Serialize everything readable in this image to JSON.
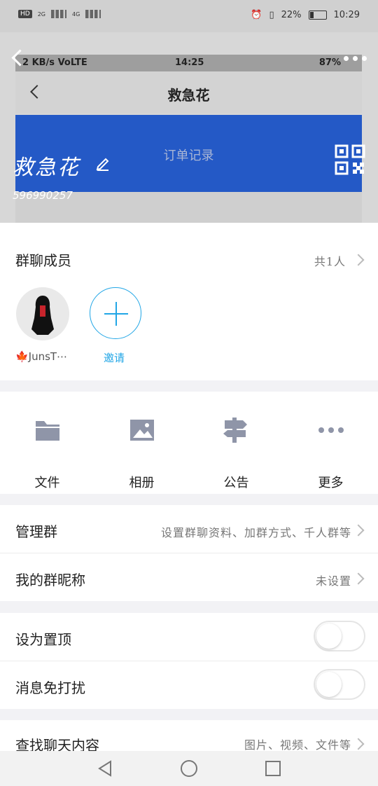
{
  "status_bar": {
    "left_badges": [
      "HD",
      "2G",
      "4G"
    ],
    "battery": "22%",
    "time": "10:29"
  },
  "inner_screenshot": {
    "status_left": "2 KB/s VoLTE",
    "status_time": "14:25",
    "status_right": "87%",
    "title": "救急花",
    "blue_button": "订单记录"
  },
  "header": {
    "group_name": "救急花",
    "group_id": "596990257"
  },
  "members": {
    "title": "群聊成员",
    "count": "共1人",
    "member_name": "🍁JunsT⋯",
    "invite_label": "邀请"
  },
  "functions": [
    {
      "label": "文件",
      "icon": "folder-icon"
    },
    {
      "label": "相册",
      "icon": "image-icon"
    },
    {
      "label": "公告",
      "icon": "signpost-icon"
    },
    {
      "label": "更多",
      "icon": "more-icon"
    }
  ],
  "settings": {
    "manage": {
      "label": "管理群",
      "value": "设置群聊资料、加群方式、千人群等"
    },
    "nickname": {
      "label": "我的群昵称",
      "value": "未设置"
    },
    "pin": {
      "label": "设为置顶",
      "on": false
    },
    "mute": {
      "label": "消息免打扰",
      "on": false
    },
    "search": {
      "label": "查找聊天内容",
      "value": "图片、视频、文件等"
    }
  },
  "colors": {
    "accent_blue": "#21a6e6",
    "inner_blue": "#2459c6",
    "icon_gray": "#8f95a8"
  }
}
